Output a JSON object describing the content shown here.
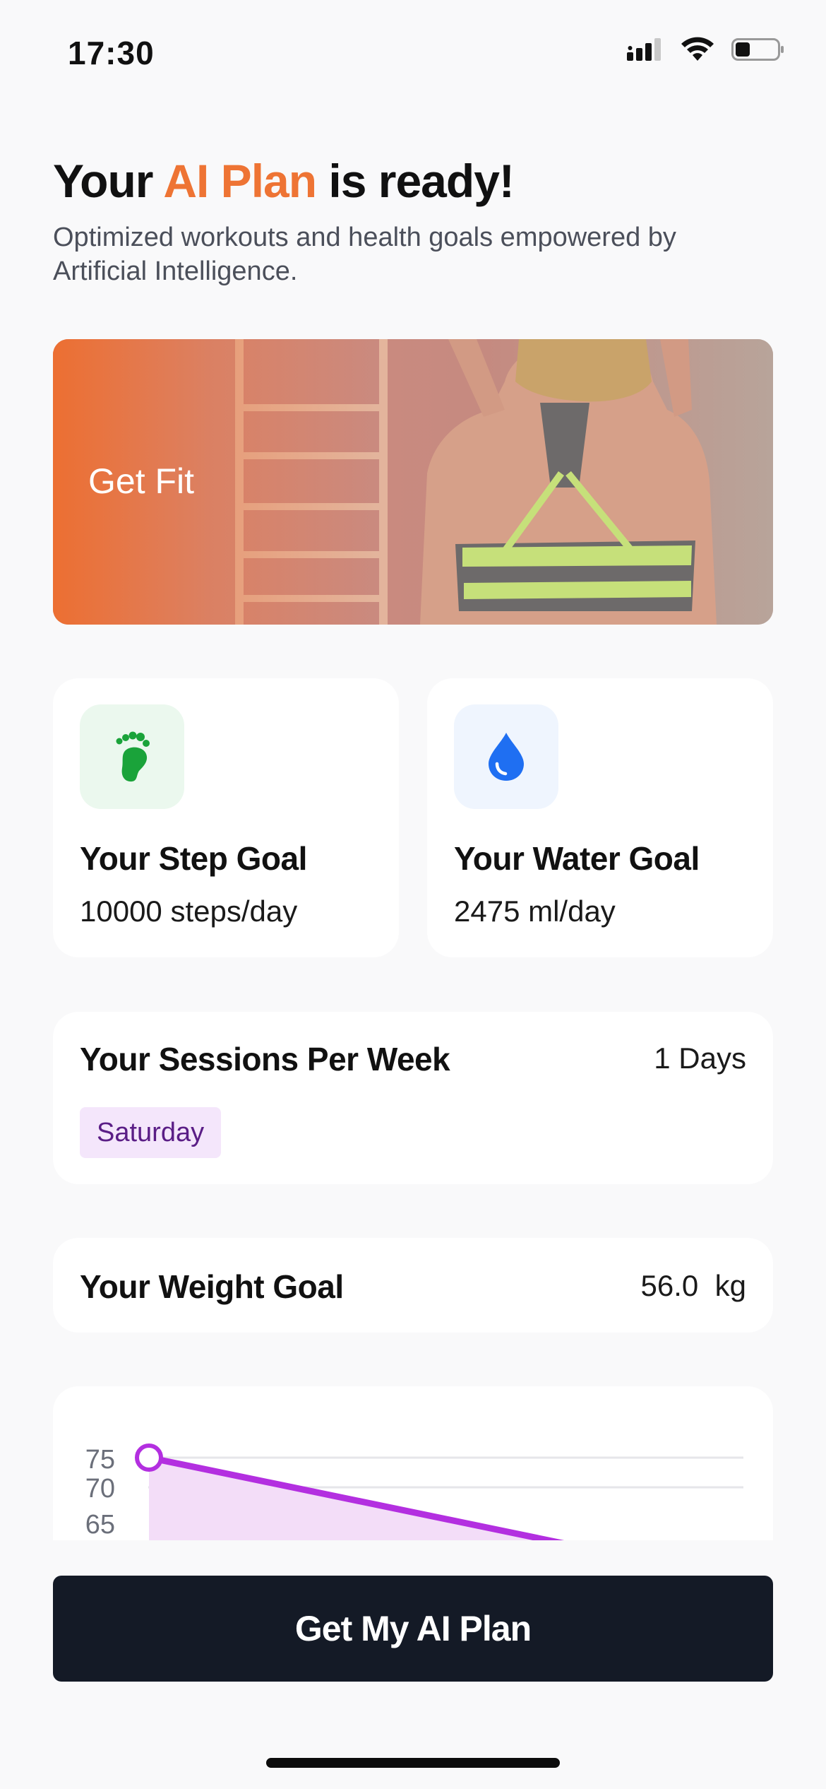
{
  "status_bar": {
    "time": "17:30",
    "battery_level": 0.3
  },
  "header": {
    "title_prefix": "Your",
    "title_accent": "AI Plan",
    "title_suffix": "is ready!",
    "subtitle": "Optimized workouts and health goals empowered by Artificial Intelligence."
  },
  "hero": {
    "label": "Get Fit"
  },
  "goals": {
    "steps": {
      "title": "Your Step Goal",
      "value": "10000 steps/day",
      "icon": "footprint-icon"
    },
    "water": {
      "title": "Your Water Goal",
      "value": "2475 ml/day",
      "icon": "water-drop-icon"
    }
  },
  "sessions": {
    "title": "Your Sessions Per Week",
    "value": "1 Days",
    "days": [
      "Saturday"
    ]
  },
  "weight": {
    "title": "Your Weight Goal",
    "value": "56.0  kg"
  },
  "chart_data": {
    "type": "area",
    "y_ticks": [
      "75",
      "70",
      "65"
    ],
    "points": [
      75
    ],
    "series_color": "#b32fe0"
  },
  "cta": {
    "label": "Get My AI Plan"
  },
  "colors": {
    "accent": "#ee7434",
    "cta": "#141a26",
    "chip": "#f4e6fb",
    "step_green": "#1aa33a",
    "water_blue": "#1f6ff2"
  }
}
